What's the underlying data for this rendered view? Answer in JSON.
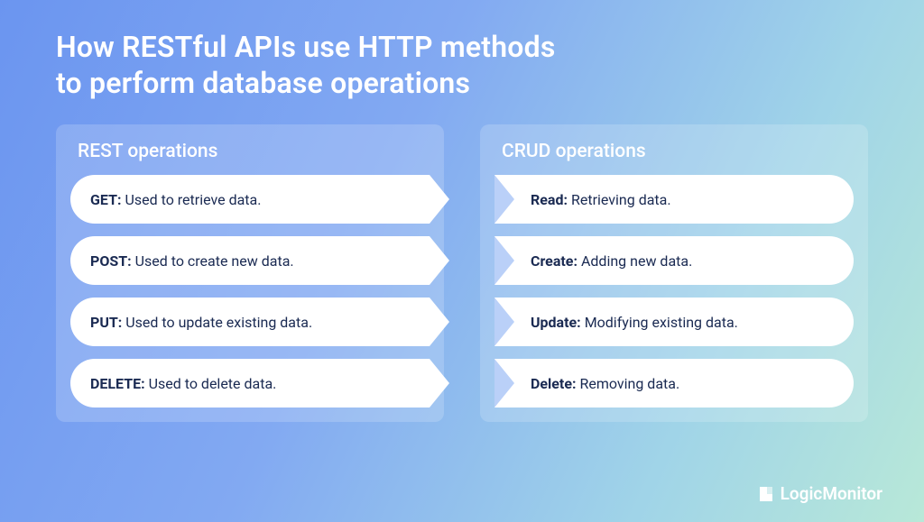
{
  "title_line1": "How RESTful APIs use HTTP methods",
  "title_line2": "to perform database operations",
  "left": {
    "header": "REST operations",
    "rows": [
      {
        "term": "GET",
        "desc": "Used to retrieve data."
      },
      {
        "term": "POST",
        "desc": "Used to create new data."
      },
      {
        "term": "PUT",
        "desc": "Used to update existing data."
      },
      {
        "term": "DELETE",
        "desc": "Used to delete data."
      }
    ]
  },
  "right": {
    "header": "CRUD operations",
    "rows": [
      {
        "term": "Read",
        "desc": "Retrieving data."
      },
      {
        "term": "Create",
        "desc": "Adding new data."
      },
      {
        "term": "Update",
        "desc": "Modifying existing data."
      },
      {
        "term": "Delete",
        "desc": "Removing data."
      }
    ]
  },
  "brand": "LogicMonitor",
  "separator": ":"
}
